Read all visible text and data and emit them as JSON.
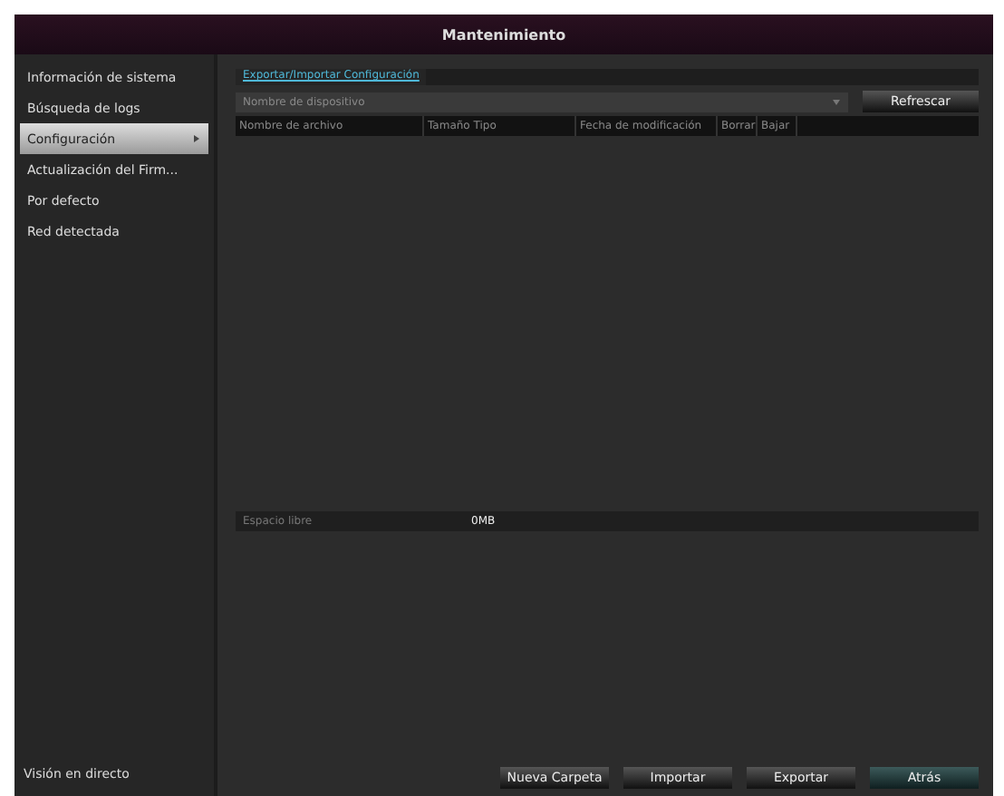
{
  "window": {
    "title": "Mantenimiento"
  },
  "sidebar": {
    "items": [
      {
        "label": "Información de sistema",
        "selected": false
      },
      {
        "label": "Búsqueda de logs",
        "selected": false
      },
      {
        "label": "Configuración",
        "selected": true
      },
      {
        "label": "Actualización del Firm...",
        "selected": false
      },
      {
        "label": "Por defecto",
        "selected": false
      },
      {
        "label": "Red detectada",
        "selected": false
      }
    ],
    "footer": "Visión en directo"
  },
  "tab": {
    "label": "Exportar/Importar Configuración"
  },
  "device_select": {
    "value": "Nombre de dispositivo"
  },
  "refresh_button": "Refrescar",
  "table": {
    "columns": [
      "Nombre de archivo",
      "Tamaño Tipo",
      "Fecha de modificación",
      "Borrar",
      "Bajar"
    ]
  },
  "free_space": {
    "label": "Espacio libre",
    "value": "0MB"
  },
  "buttons": [
    {
      "label": "Nueva Carpeta",
      "primary": false
    },
    {
      "label": "Importar",
      "primary": false
    },
    {
      "label": "Exportar",
      "primary": false
    },
    {
      "label": "Atrás",
      "primary": true
    }
  ]
}
